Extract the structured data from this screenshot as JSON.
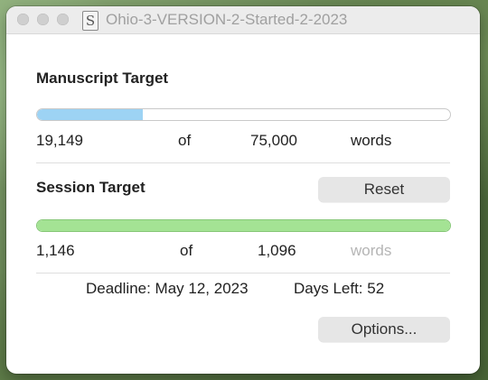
{
  "window": {
    "title": "Ohio-3-VERSION-2-Started-2-2023",
    "app_icon": "scrivener-icon",
    "app_icon_glyph": "S"
  },
  "manuscript": {
    "heading": "Manuscript Target",
    "current": "19,149",
    "of_label": "of",
    "target": "75,000",
    "unit": "words",
    "progress_fraction": 0.255,
    "bar_color": "#9dd3f4"
  },
  "session": {
    "heading": "Session Target",
    "reset_label": "Reset",
    "current": "1,146",
    "of_label": "of",
    "target": "1,096",
    "unit": "words",
    "progress_fraction": 1.0,
    "bar_color": "#a4e394"
  },
  "footer": {
    "deadline": "Deadline: May 12, 2023",
    "days_left": "Days Left: 52",
    "options_label": "Options..."
  }
}
